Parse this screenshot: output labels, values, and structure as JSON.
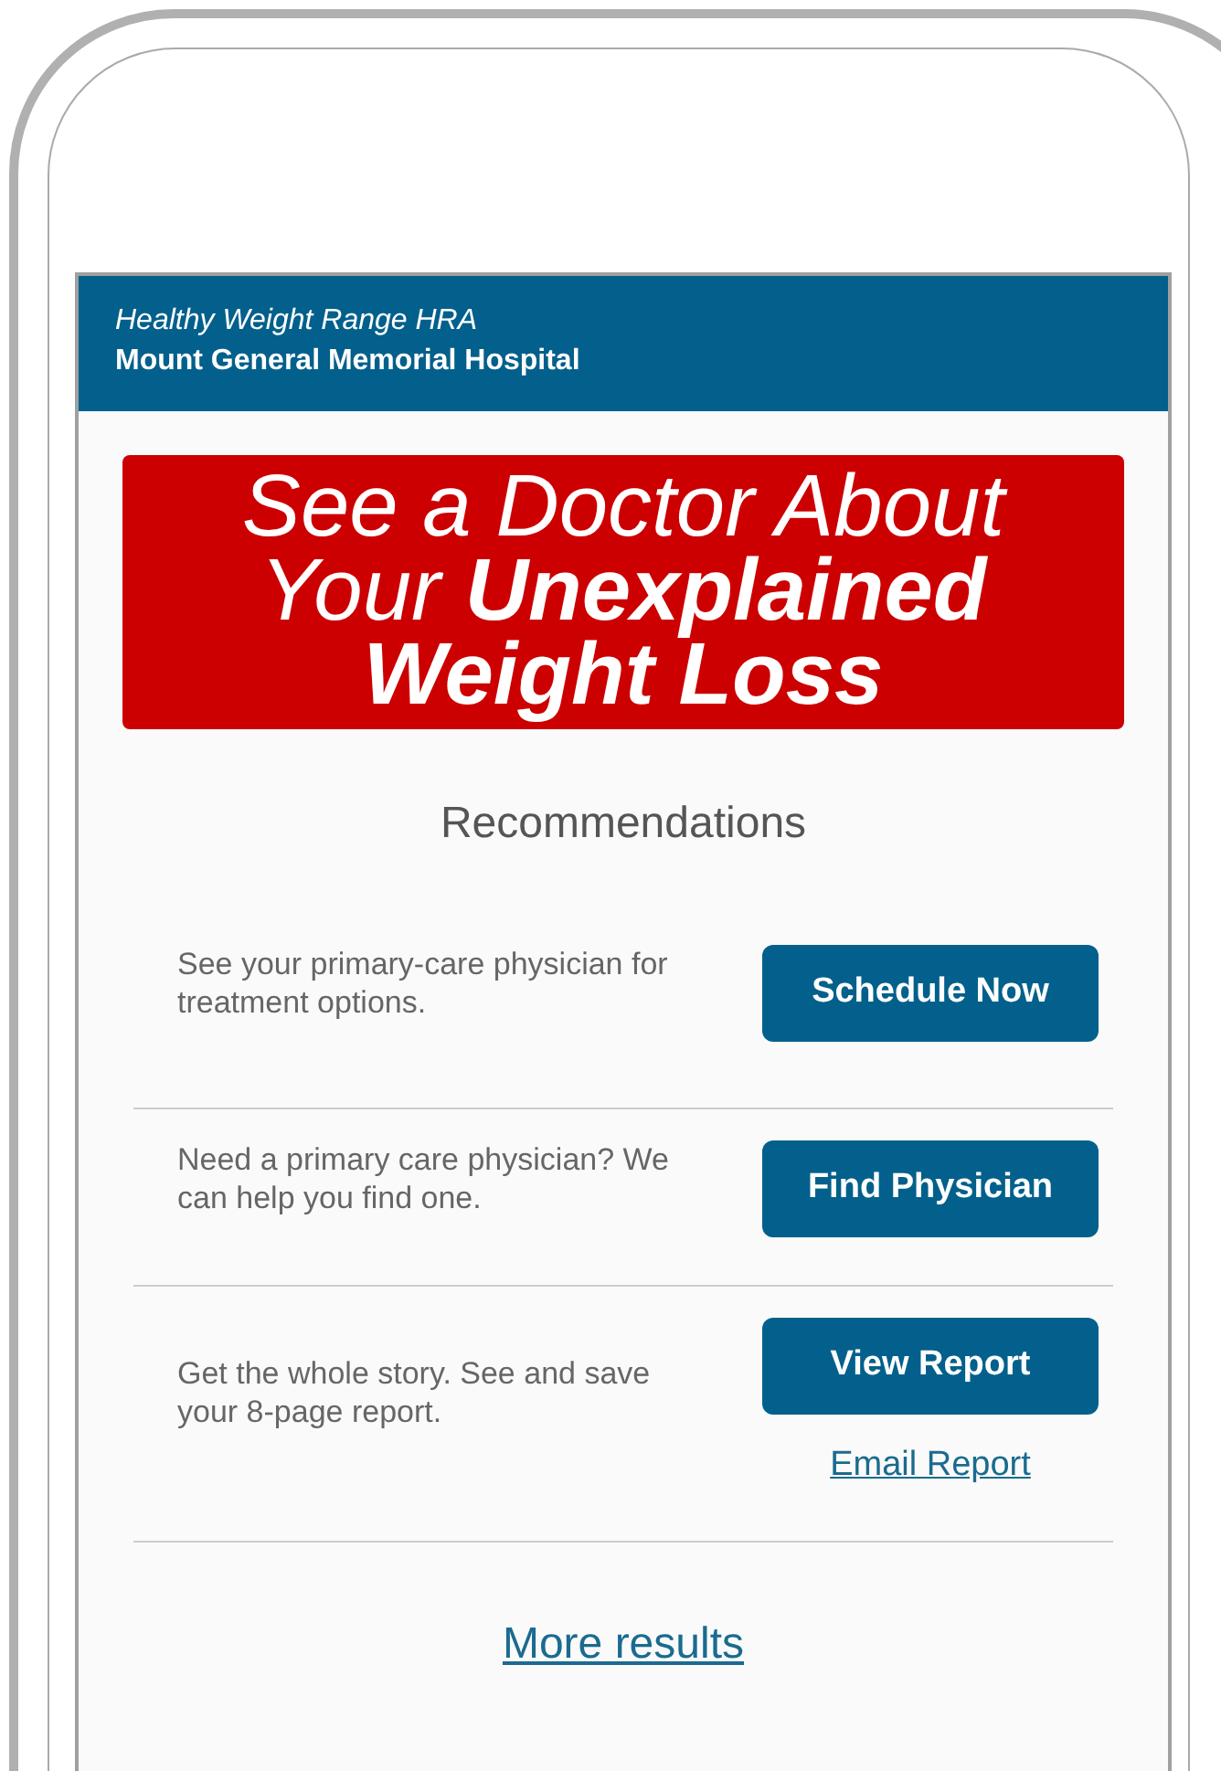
{
  "header": {
    "subtitle": "Healthy Weight Range HRA",
    "title": "Mount General Memorial Hospital"
  },
  "banner": {
    "headline": "See a Doctor About Your **Unexplained Weight Loss**"
  },
  "recommendations": {
    "heading": "Recommendations",
    "items": [
      {
        "text": "See your primary-care physician for treatment options.",
        "button": "Schedule Now"
      },
      {
        "text": "Need a primary care physician? We can help you find one.",
        "button": "Find Physician"
      },
      {
        "text": "Get the whole story. See and save your 8-page report.",
        "button": "View Report",
        "link": "Email Report"
      }
    ]
  },
  "more_link": "More results"
}
